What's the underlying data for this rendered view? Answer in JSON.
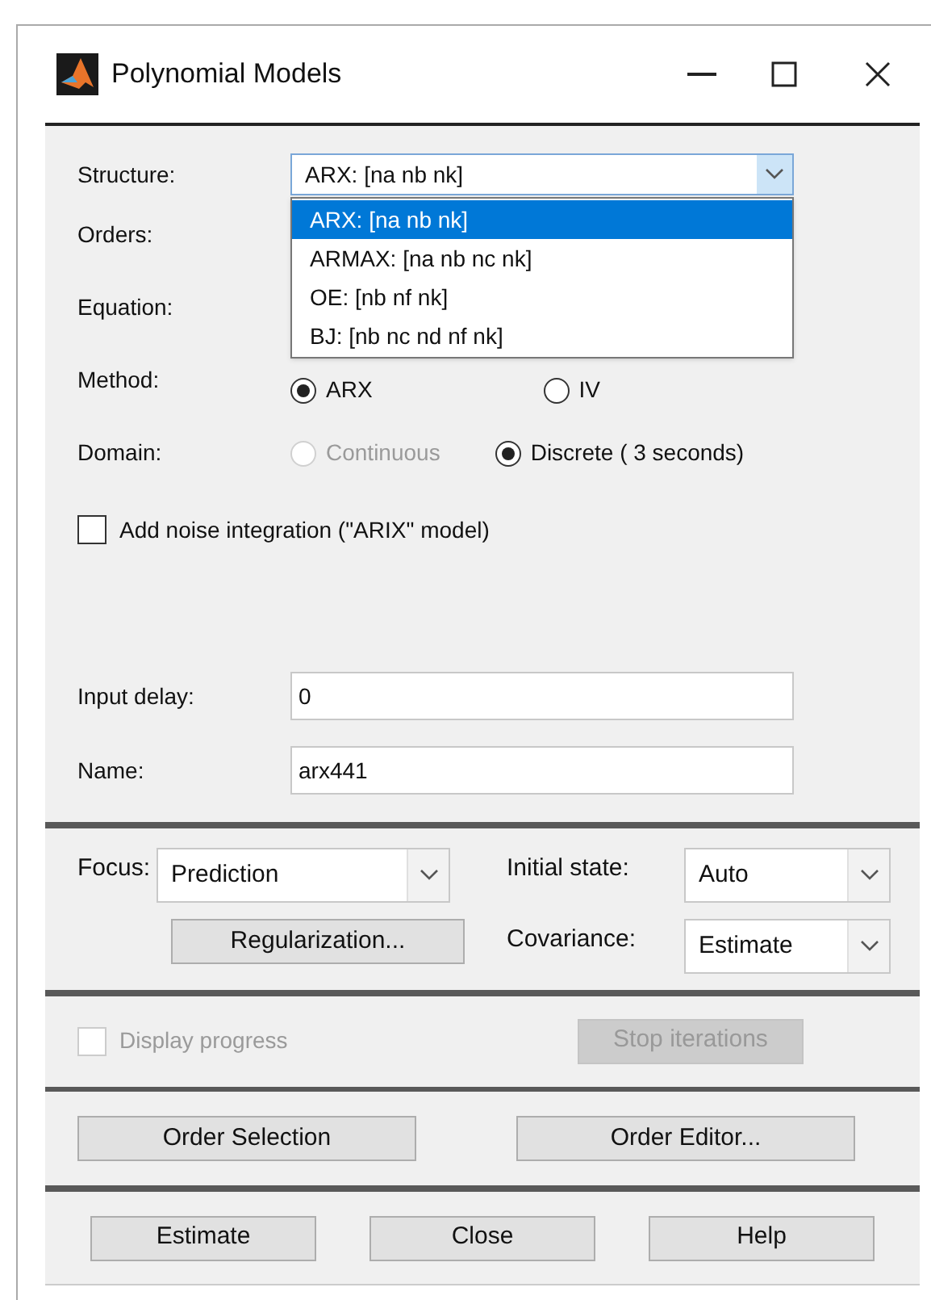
{
  "window": {
    "title": "Polynomial Models"
  },
  "structure": {
    "label": "Structure:",
    "value": "ARX: [na nb nk]",
    "expanded": true,
    "options": [
      {
        "label": "ARX: [na nb nk]",
        "selected": true
      },
      {
        "label": "ARMAX: [na nb nc nk]",
        "selected": false
      },
      {
        "label": "OE: [nb nf nk]",
        "selected": false
      },
      {
        "label": "BJ: [nb nc nd nf nk]",
        "selected": false
      }
    ]
  },
  "orders": {
    "label": "Orders:"
  },
  "equation": {
    "label": "Equation:"
  },
  "method": {
    "label": "Method:",
    "options": [
      {
        "label": "ARX",
        "selected": true
      },
      {
        "label": "IV",
        "selected": false
      }
    ]
  },
  "domain": {
    "label": "Domain:",
    "options": [
      {
        "label": "Continuous",
        "selected": false,
        "disabled": true
      },
      {
        "label": "Discrete ( 3 seconds)",
        "selected": true,
        "disabled": false
      }
    ]
  },
  "noise_integration": {
    "label": "Add noise integration (\"ARIX\" model)",
    "checked": false
  },
  "input_delay": {
    "label": "Input delay:",
    "value": "0"
  },
  "name": {
    "label": "Name:",
    "value": "arx441"
  },
  "focus": {
    "label": "Focus:",
    "value": "Prediction"
  },
  "regularization": {
    "label": "Regularization..."
  },
  "initial_state": {
    "label": "Initial state:",
    "value": "Auto"
  },
  "covariance": {
    "label": "Covariance:",
    "value": "Estimate"
  },
  "display_progress": {
    "label": "Display progress",
    "checked": false,
    "disabled": true
  },
  "stop_iterations": {
    "label": "Stop iterations",
    "disabled": true
  },
  "order_buttons": [
    "Order Selection",
    "Order Editor..."
  ],
  "buttons": [
    "Estimate",
    "Close",
    "Help"
  ]
}
